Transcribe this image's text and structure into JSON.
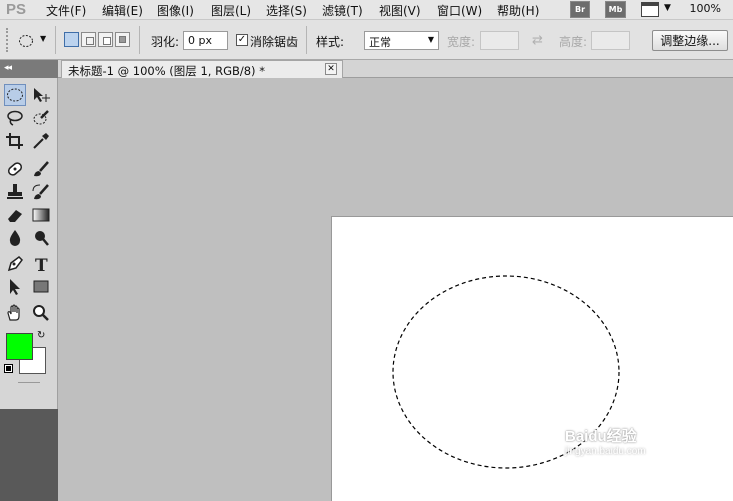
{
  "app": {
    "logo": "PS"
  },
  "menu": [
    {
      "label": "文件(F)"
    },
    {
      "label": "编辑(E)"
    },
    {
      "label": "图像(I)"
    },
    {
      "label": "图层(L)"
    },
    {
      "label": "选择(S)"
    },
    {
      "label": "滤镜(T)"
    },
    {
      "label": "视图(V)"
    },
    {
      "label": "窗口(W)"
    },
    {
      "label": "帮助(H)"
    }
  ],
  "menubar_buttons": {
    "br": "Br",
    "mb": "Mb"
  },
  "zoom": "100%",
  "options": {
    "feather_label": "羽化:",
    "feather_value": "0 px",
    "antialias_checked": true,
    "antialias_label": "消除锯齿",
    "style_label": "样式:",
    "style_value": "正常",
    "width_label": "宽度:",
    "height_label": "高度:",
    "refine_edge_label": "调整边缘..."
  },
  "document": {
    "tab_title": "未标题-1 @ 100% (图层 1, RGB/8) *",
    "close_glyph": "✕"
  },
  "colors": {
    "foreground": "#00ff00",
    "background": "#ffffff"
  },
  "watermark": {
    "line1": "Baidu经验",
    "line2": "jingyan.baidu.com"
  },
  "icons": {
    "marquee_tool": "elliptical-marquee-icon",
    "move_tool": "move-icon",
    "lasso_tool": "lasso-icon",
    "quick_select_tool": "quick-selection-icon",
    "crop_tool": "crop-icon",
    "eyedropper_tool": "eyedropper-icon",
    "healing_tool": "healing-brush-icon",
    "brush_tool": "brush-icon",
    "stamp_tool": "clone-stamp-icon",
    "history_brush_tool": "history-brush-icon",
    "eraser_tool": "eraser-icon",
    "gradient_tool": "gradient-icon",
    "blur_tool": "blur-icon",
    "dodge_tool": "dodge-icon",
    "pen_tool": "pen-icon",
    "type_tool": "type-icon",
    "path_select_tool": "path-selection-icon",
    "shape_tool": "rectangle-shape-icon",
    "hand_tool": "hand-icon",
    "zoom_tool": "zoom-icon"
  }
}
